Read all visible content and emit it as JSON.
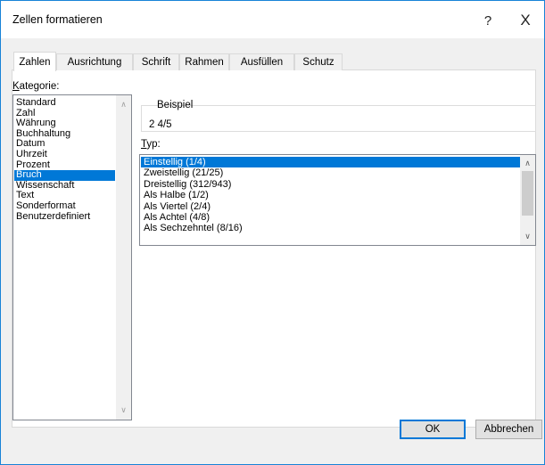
{
  "window": {
    "title": "Zellen formatieren",
    "help_label": "?",
    "close_label": "X"
  },
  "tabs": [
    {
      "label": "Zahlen",
      "active": true
    },
    {
      "label": "Ausrichtung",
      "active": false
    },
    {
      "label": "Schrift",
      "active": false
    },
    {
      "label": "Rahmen",
      "active": false
    },
    {
      "label": "Ausfüllen",
      "active": false
    },
    {
      "label": "Schutz",
      "active": false
    }
  ],
  "kategorie": {
    "label_prefix": "K",
    "label_rest": "ategorie:",
    "items": [
      "Standard",
      "Zahl",
      "Währung",
      "Buchhaltung",
      "Datum",
      "Uhrzeit",
      "Prozent",
      "Bruch",
      "Wissenschaft",
      "Text",
      "Sonderformat",
      "Benutzerdefiniert"
    ],
    "selected": "Bruch"
  },
  "beispiel": {
    "label": "Beispiel",
    "value": "2 4/5"
  },
  "typ": {
    "label_prefix": "T",
    "label_rest": "yp:",
    "items": [
      "Einstellig (1/4)",
      "Zweistellig (21/25)",
      "Dreistellig (312/943)",
      "Als Halbe (1/2)",
      "Als Viertel (2/4)",
      "Als Achtel (4/8)",
      "Als Sechzehntel (8/16)"
    ],
    "selected": "Einstellig (1/4)"
  },
  "buttons": {
    "ok": "OK",
    "cancel": "Abbrechen"
  },
  "colors": {
    "accent": "#0078d7",
    "window_border": "#1883d7"
  }
}
